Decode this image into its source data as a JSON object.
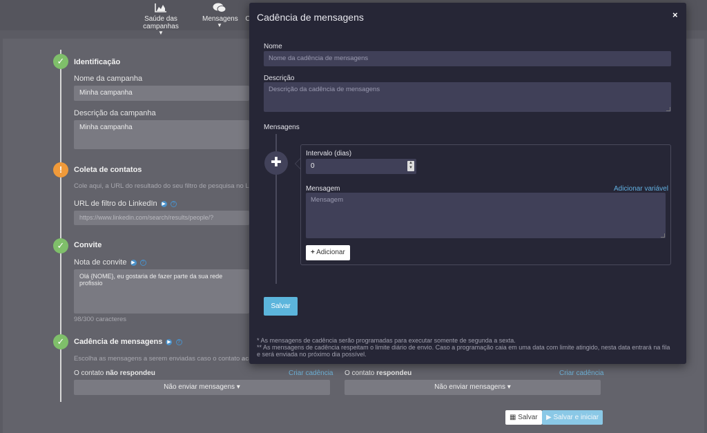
{
  "nav": {
    "items": [
      {
        "label": "Saúde das campanhas",
        "icon": "area-chart-icon"
      },
      {
        "label": "Mensagens",
        "icon": "chat-icon"
      },
      {
        "label": "C"
      }
    ]
  },
  "sections": {
    "identificacao": {
      "heading": "Identificação",
      "name_label": "Nome da campanha",
      "name_value": "Minha campanha",
      "desc_label": "Descrição da campanha",
      "desc_value": "Minha campanha"
    },
    "coleta": {
      "heading": "Coleta de contatos",
      "help_text": "Cole aqui, a URL do resultado do seu filtro de pesquisa no L",
      "url_label": "URL de filtro do LinkedIn",
      "url_placeholder": "https://www.linkedin.com/search/results/people/?"
    },
    "convite": {
      "heading": "Convite",
      "note_label": "Nota de convite",
      "note_value": "Olá {NOME}, eu gostaria de fazer parte da sua rede profissio",
      "char_count": "98/300 caracteres"
    },
    "cadencia": {
      "heading": "Cadência de mensagens",
      "help_text_start": "Escolha as mensagens a serem enviadas caso o contato ",
      "help_text_bold": "ace",
      "left_prefix": "O contato ",
      "left_bold": "não respondeu",
      "right_prefix": "O contato ",
      "right_bold": "respondeu",
      "create_link": "Criar cadência",
      "dropdown_label": "Não enviar mensagens"
    }
  },
  "footer": {
    "save": "Salvar",
    "save_start": "Salvar e iniciar"
  },
  "modal": {
    "title": "Cadência de mensagens",
    "close": "×",
    "name_label": "Nome",
    "name_placeholder": "Nome da cadência de mensagens",
    "desc_label": "Descrição",
    "desc_placeholder": "Descrição da cadência de mensagens",
    "messages_label": "Mensagens",
    "interval_label": "Intervalo (dias)",
    "interval_value": "0",
    "message_label": "Mensagem",
    "add_variable": "Adicionar variável",
    "message_placeholder": "Mensagem",
    "add_button": "Adicionar",
    "save_button": "Salvar",
    "note1": "*   As mensagens de cadência serão programadas para executar somente de segunda a sexta.",
    "note2": "** As mensagens de cadência respeitam o limite diário de envio. Caso a programação caia em uma data com limite atingido, nesta data entrará na fila e será enviada no próximo dia possível."
  },
  "colors": {
    "accent": "#5cb5dc",
    "success": "#7fbf6a",
    "warning": "#f09a3a",
    "modal_bg": "#262636"
  }
}
